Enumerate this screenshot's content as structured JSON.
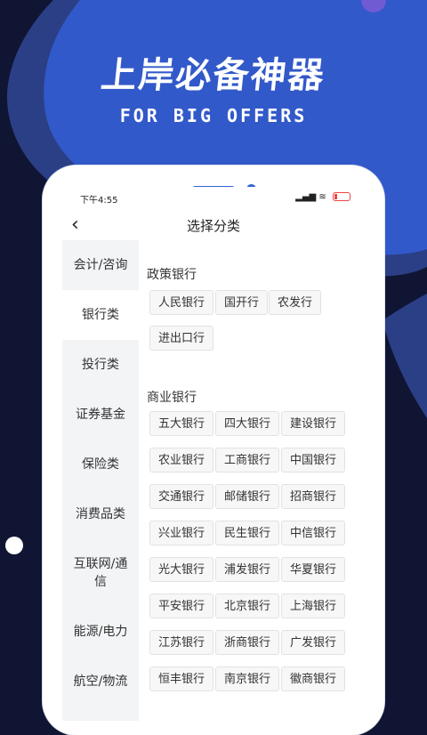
{
  "hero": {
    "title": "上岸必备神器",
    "subtitle": "FOR BIG OFFERS"
  },
  "colors": {
    "background_dark": "#0f1533",
    "accent_blue": "#3259c9",
    "blob_blue": "#2b47a0"
  },
  "status_bar": {
    "time": "下午4:55",
    "icons": [
      "alarm-icon",
      "signal-icon",
      "wifi-icon",
      "battery-icon"
    ]
  },
  "nav": {
    "back_icon": "chevron-left-icon",
    "title": "选择分类"
  },
  "sidebar": {
    "items": [
      {
        "label": "会计/咨询",
        "active": false
      },
      {
        "label": "银行类",
        "active": true
      },
      {
        "label": "投行类",
        "active": false
      },
      {
        "label": "证券基金",
        "active": false
      },
      {
        "label": "保险类",
        "active": false
      },
      {
        "label": "消费品类",
        "active": false
      },
      {
        "label": "互联网/通信",
        "active": false
      },
      {
        "label": "能源/电力",
        "active": false
      },
      {
        "label": "航空/物流",
        "active": false
      }
    ]
  },
  "sections": [
    {
      "title": "政策银行",
      "tags": [
        "人民银行",
        "国开行",
        "农发行",
        "进出口行"
      ]
    },
    {
      "title": "商业银行",
      "tags": [
        "五大银行",
        "四大银行",
        "建设银行",
        "农业银行",
        "工商银行",
        "中国银行",
        "交通银行",
        "邮储银行",
        "招商银行",
        "兴业银行",
        "民生银行",
        "中信银行",
        "光大银行",
        "浦发银行",
        "华夏银行",
        "平安银行",
        "北京银行",
        "上海银行",
        "江苏银行",
        "浙商银行",
        "广发银行",
        "恒丰银行",
        "南京银行",
        "徽商银行"
      ]
    }
  ]
}
